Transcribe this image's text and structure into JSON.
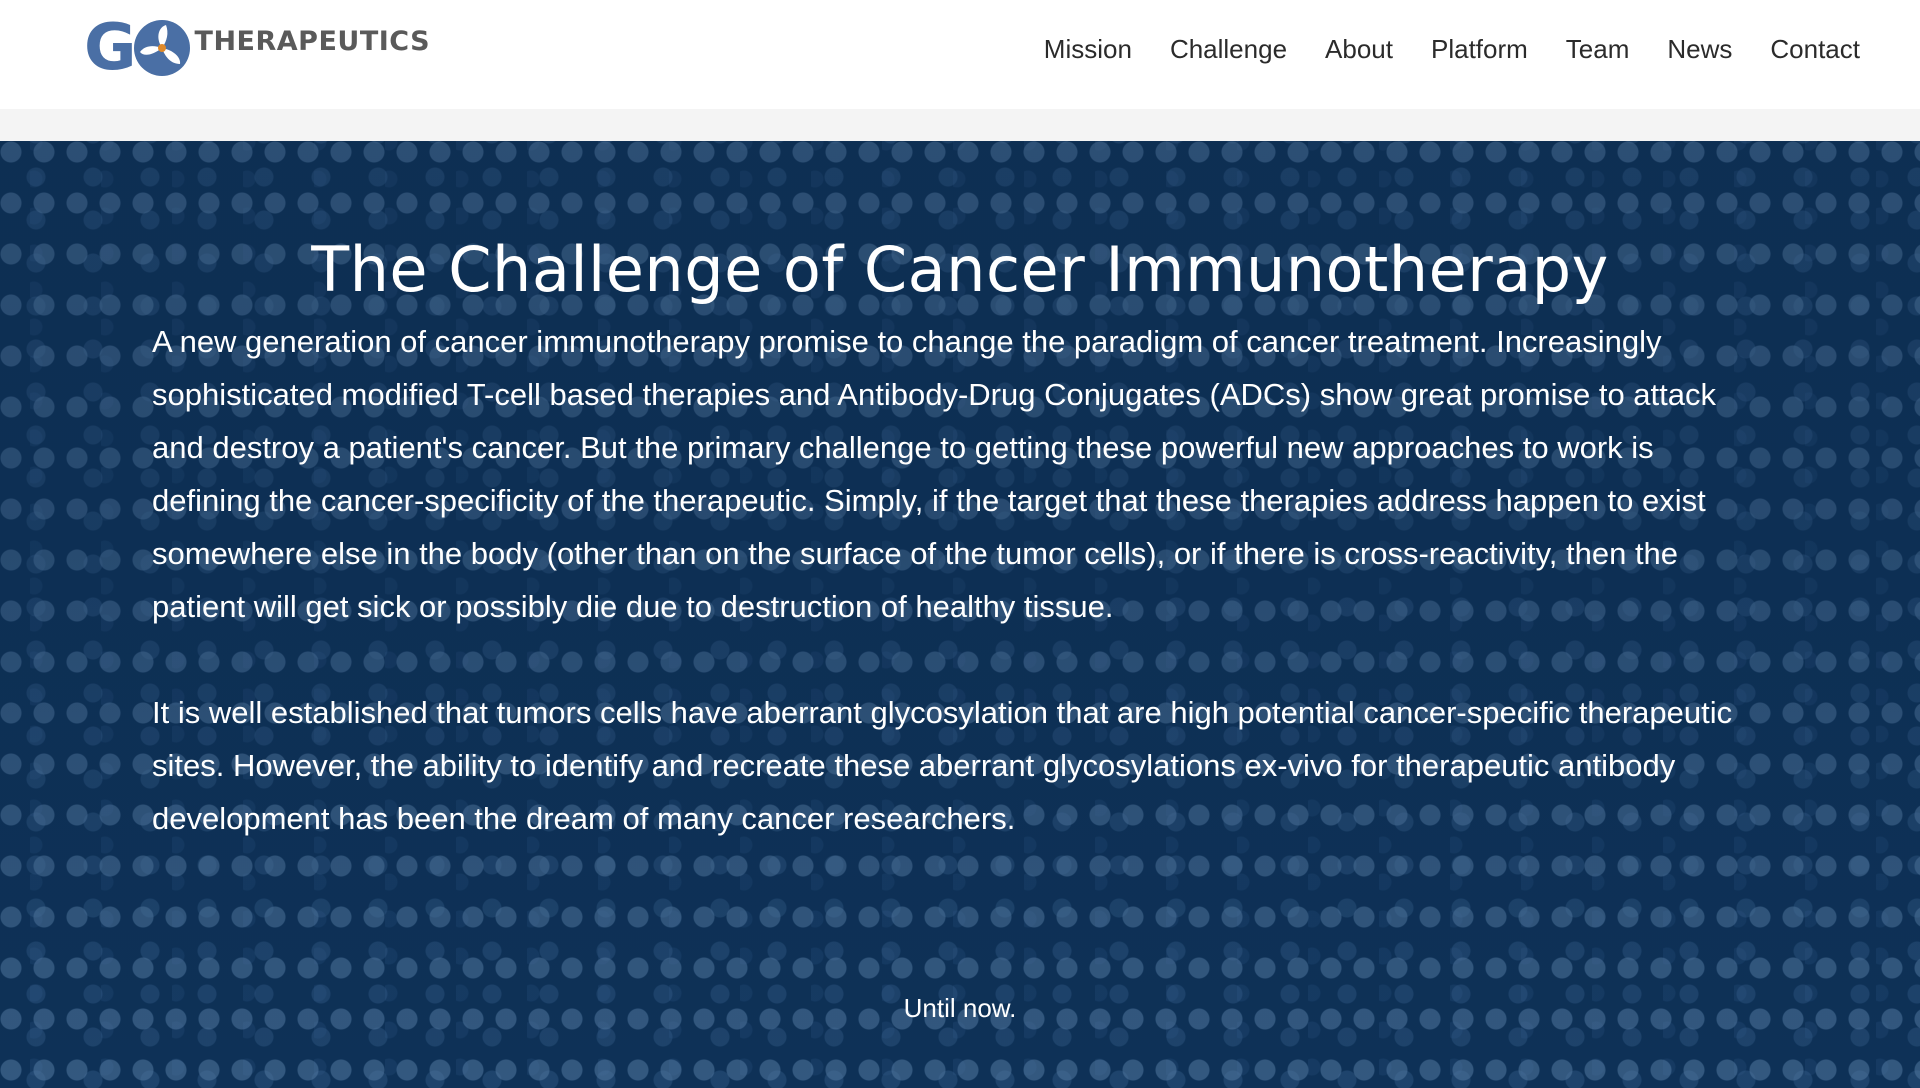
{
  "brand": {
    "logo_text": "THERAPEUTICS",
    "logo_letter": "G",
    "primary_color": "#4a6fa5",
    "accent_color": "#e08a2a"
  },
  "nav": {
    "items": [
      {
        "label": "Mission"
      },
      {
        "label": "Challenge"
      },
      {
        "label": "About"
      },
      {
        "label": "Platform"
      },
      {
        "label": "Team"
      },
      {
        "label": "News"
      },
      {
        "label": "Contact"
      }
    ]
  },
  "hero": {
    "background_color": "#0f3760",
    "title": "The Challenge of Cancer Immunotherapy",
    "paragraphs": [
      "A new generation of cancer immunotherapy promise to change the paradigm of cancer treatment. Increasingly sophisticated modified T-cell based therapies and Antibody-Drug Conjugates (ADCs) show great promise to attack and destroy a patient's cancer. But the primary challenge to getting these powerful new approaches to work is defining the cancer-specificity of the therapeutic. Simply, if the target that these therapies address happen to exist somewhere else in the body (other than on the surface of the tumor cells), or if there is cross-reactivity, then the patient will get sick or possibly die due to destruction of healthy tissue.",
      "It is well established that tumors cells have aberrant glycosylation that are high potential cancer-specific therapeutic sites. However, the ability to identify and recreate these aberrant glycosylations ex-vivo for therapeutic antibody development has been the dream of many cancer researchers."
    ],
    "closing": "Until now."
  }
}
